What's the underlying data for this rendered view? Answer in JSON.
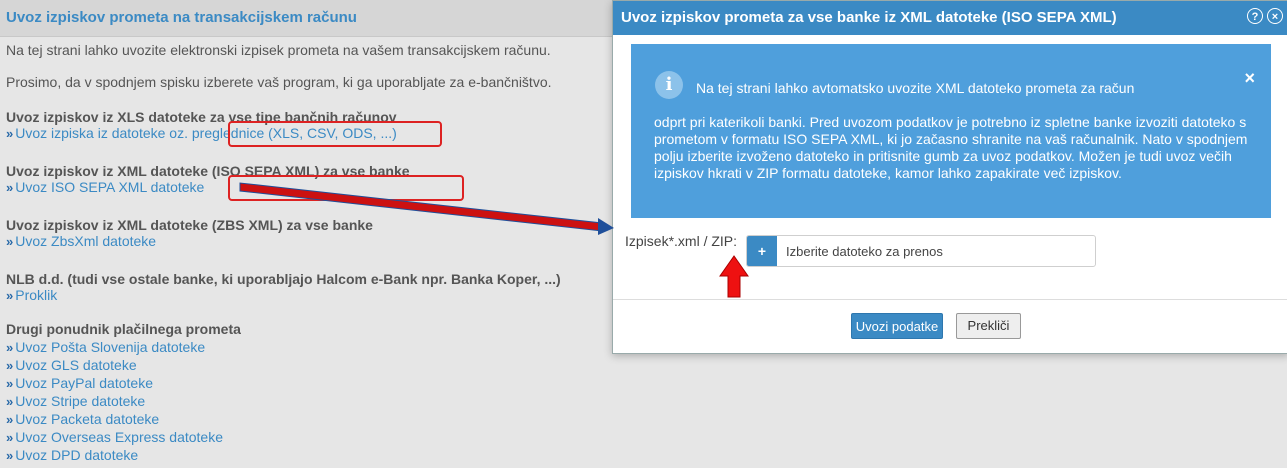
{
  "page": {
    "title": "Uvoz izpiskov prometa na transakcijskem računu",
    "intro1": "Na tej strani lahko uvozite elektronski izpisek prometa na vašem transakcijskem računu.",
    "intro2": "Prosimo, da v spodnjem spisku izberete vaš program, ki ga uporabljate za e-bančništvo.",
    "chevron": "»",
    "sections": [
      {
        "title": "Uvoz izpiskov iz XLS datoteke za vse tipe bančnih računov",
        "links": [
          "Uvoz izpiska iz datoteke oz. preglednice (XLS, CSV, ODS, ...)"
        ]
      },
      {
        "title": "Uvoz izpiskov iz XML datoteke (ISO SEPA XML) za vse banke",
        "links": [
          "Uvoz ISO SEPA XML datoteke"
        ]
      },
      {
        "title": "Uvoz izpiskov iz XML datoteke (ZBS XML) za vse banke",
        "links": [
          "Uvoz ZbsXml datoteke"
        ]
      },
      {
        "title": "NLB d.d. (tudi vse ostale banke, ki uporabljajo Halcom e-Bank npr. Banka Koper, ...)",
        "links": [
          "Proklik"
        ]
      },
      {
        "title": "Drugi ponudnik plačilnega prometa",
        "links": [
          "Uvoz Pošta Slovenija datoteke",
          "Uvoz GLS datoteke",
          "Uvoz PayPal datoteke",
          "Uvoz Stripe datoteke",
          "Uvoz Packeta datoteke",
          "Uvoz Overseas Express datoteke",
          "Uvoz DPD datoteke"
        ]
      }
    ]
  },
  "modal": {
    "title": "Uvoz izpiskov prometa za vse banke iz XML datoteke (ISO SEPA XML)",
    "help_icon": "?",
    "close_icon": "×",
    "info": {
      "icon": "i",
      "close": "×",
      "line1": "Na tej strani lahko avtomatsko uvozite XML datoteko prometa za račun",
      "body": "odprt pri katerikoli banki. Pred uvozom podatkov je potrebno iz spletne banke izvoziti datoteko s prometom v formatu ISO SEPA XML, ki jo začasno shranite na vaš računalnik. Nato v spodnjem polju izberite izvoženo datoteko in pritisnite gumb za uvoz podatkov. Možen je tudi uvoz večih izpiskov hkrati v ZIP formatu datoteke, kamor lahko zapakirate več izpiskov."
    },
    "file_label": "Izpisek*.xml / ZIP:",
    "file_button": "+",
    "file_placeholder": "Izberite datoteko za prenos",
    "import_button": "Uvozi podatke",
    "cancel_button": "Prekliči"
  },
  "colors": {
    "accent": "#3b8ac4",
    "info_bg": "#4f9fdc",
    "highlight": "#dd2222",
    "arrow_line": "#cc1111",
    "arrow_tip": "#1f4f9a"
  }
}
